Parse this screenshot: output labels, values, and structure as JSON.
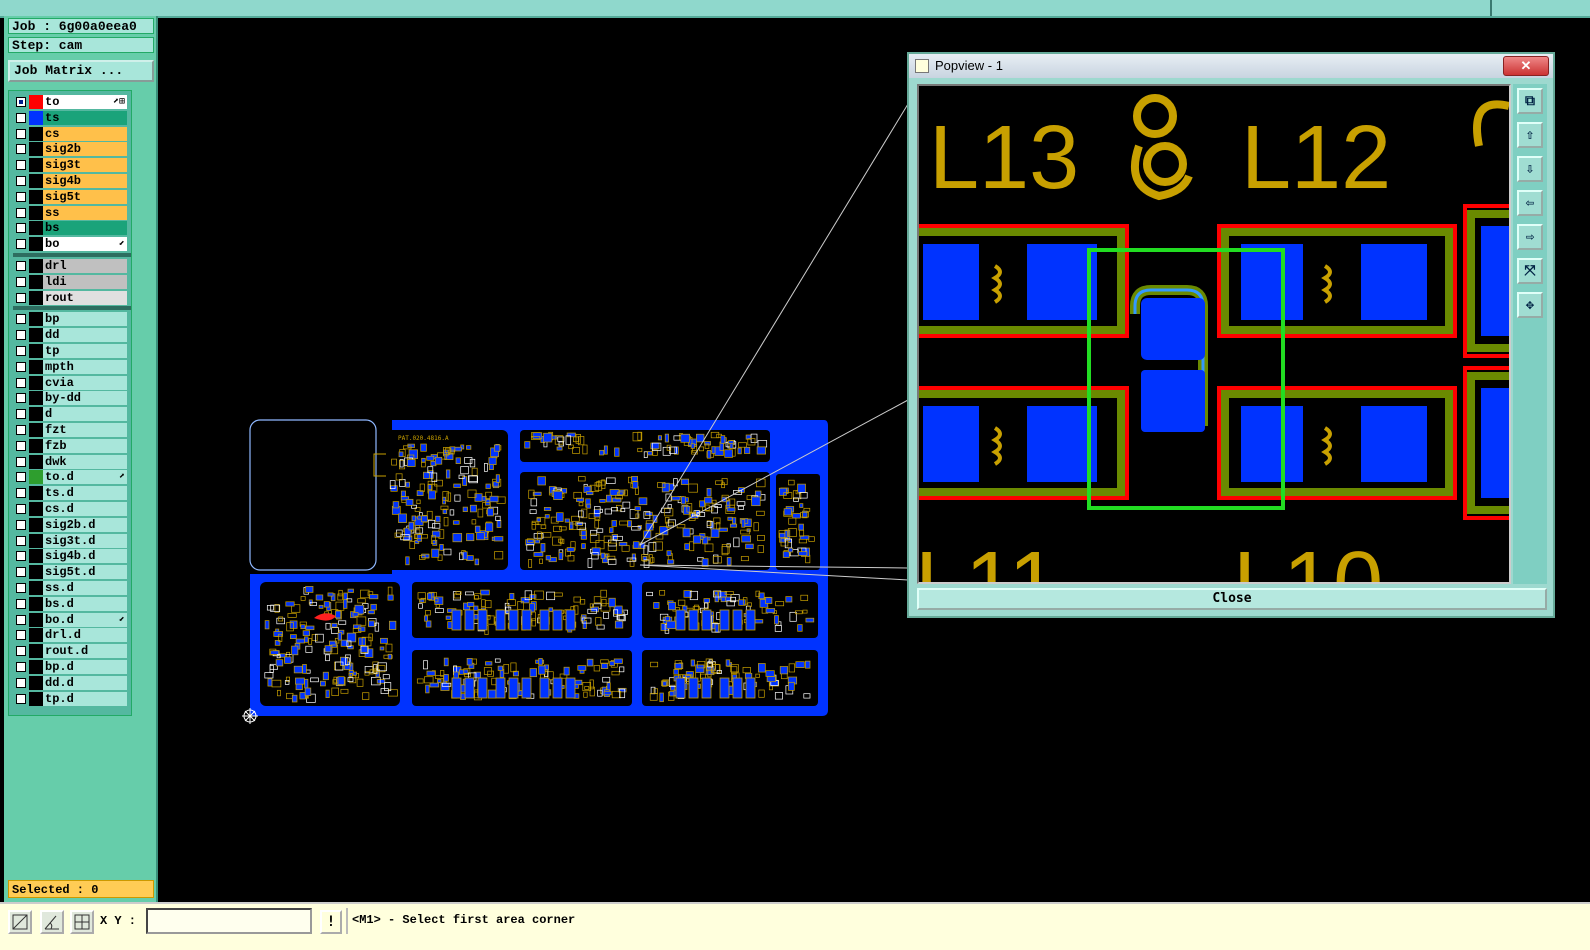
{
  "header": {
    "job_label": "Job : 6g00a0eea0",
    "step_label": "Step: cam",
    "job_matrix_button": "Job Matrix ..."
  },
  "layers": {
    "board": [
      {
        "name": "to",
        "bg": "#ffffff",
        "swatch": "#ff0000",
        "checked": true,
        "mark": "⬈⊞"
      },
      {
        "name": "ts",
        "bg": "#1aa37a",
        "swatch": "#0033ff",
        "checked": false,
        "mark": ""
      },
      {
        "name": "cs",
        "bg": "#ffc04a",
        "swatch": "#000000",
        "checked": false,
        "mark": ""
      },
      {
        "name": "sig2b",
        "bg": "#ffc04a",
        "swatch": "#000000",
        "checked": false,
        "mark": ""
      },
      {
        "name": "sig3t",
        "bg": "#ffc04a",
        "swatch": "#000000",
        "checked": false,
        "mark": ""
      },
      {
        "name": "sig4b",
        "bg": "#ffc04a",
        "swatch": "#000000",
        "checked": false,
        "mark": ""
      },
      {
        "name": "sig5t",
        "bg": "#ffc04a",
        "swatch": "#000000",
        "checked": false,
        "mark": ""
      },
      {
        "name": "ss",
        "bg": "#ffc04a",
        "swatch": "#000000",
        "checked": false,
        "mark": ""
      },
      {
        "name": "bs",
        "bg": "#1aa37a",
        "swatch": "#000000",
        "checked": false,
        "mark": ""
      },
      {
        "name": "bo",
        "bg": "#ffffff",
        "swatch": "#000000",
        "checked": false,
        "mark": "⬋"
      }
    ],
    "drill": [
      {
        "name": "drl",
        "bg": "#c0c0c0",
        "swatch": "#000000",
        "checked": false,
        "mark": ""
      },
      {
        "name": "ldi",
        "bg": "#c0c0c0",
        "swatch": "#000000",
        "checked": false,
        "mark": ""
      },
      {
        "name": "rout",
        "bg": "#e0e0e0",
        "swatch": "#000000",
        "checked": false,
        "mark": ""
      }
    ],
    "misc": [
      {
        "name": "bp",
        "bg": "#a8e6da",
        "swatch": "#000000",
        "checked": false,
        "mark": ""
      },
      {
        "name": "dd",
        "bg": "#a8e6da",
        "swatch": "#000000",
        "checked": false,
        "mark": ""
      },
      {
        "name": "tp",
        "bg": "#a8e6da",
        "swatch": "#000000",
        "checked": false,
        "mark": ""
      },
      {
        "name": "mpth",
        "bg": "#a8e6da",
        "swatch": "#000000",
        "checked": false,
        "mark": ""
      },
      {
        "name": "cvia",
        "bg": "#a8e6da",
        "swatch": "#000000",
        "checked": false,
        "mark": ""
      },
      {
        "name": "by-dd",
        "bg": "#a8e6da",
        "swatch": "#000000",
        "checked": false,
        "mark": ""
      },
      {
        "name": "d",
        "bg": "#a8e6da",
        "swatch": "#000000",
        "checked": false,
        "mark": ""
      },
      {
        "name": "fzt",
        "bg": "#a8e6da",
        "swatch": "#000000",
        "checked": false,
        "mark": ""
      },
      {
        "name": "fzb",
        "bg": "#a8e6da",
        "swatch": "#000000",
        "checked": false,
        "mark": ""
      },
      {
        "name": "dwk",
        "bg": "#a8e6da",
        "swatch": "#000000",
        "checked": false,
        "mark": ""
      },
      {
        "name": "to.d",
        "bg": "#a8e6da",
        "swatch": "#2e9e2e",
        "checked": false,
        "mark": "⬈"
      },
      {
        "name": "ts.d",
        "bg": "#a8e6da",
        "swatch": "#000000",
        "checked": false,
        "mark": ""
      },
      {
        "name": "cs.d",
        "bg": "#a8e6da",
        "swatch": "#000000",
        "checked": false,
        "mark": ""
      },
      {
        "name": "sig2b.d",
        "bg": "#a8e6da",
        "swatch": "#000000",
        "checked": false,
        "mark": ""
      },
      {
        "name": "sig3t.d",
        "bg": "#a8e6da",
        "swatch": "#000000",
        "checked": false,
        "mark": ""
      },
      {
        "name": "sig4b.d",
        "bg": "#a8e6da",
        "swatch": "#000000",
        "checked": false,
        "mark": ""
      },
      {
        "name": "sig5t.d",
        "bg": "#a8e6da",
        "swatch": "#000000",
        "checked": false,
        "mark": ""
      },
      {
        "name": "ss.d",
        "bg": "#a8e6da",
        "swatch": "#000000",
        "checked": false,
        "mark": ""
      },
      {
        "name": "bs.d",
        "bg": "#a8e6da",
        "swatch": "#000000",
        "checked": false,
        "mark": ""
      },
      {
        "name": "bo.d",
        "bg": "#a8e6da",
        "swatch": "#000000",
        "checked": false,
        "mark": "⬋"
      },
      {
        "name": "drl.d",
        "bg": "#a8e6da",
        "swatch": "#000000",
        "checked": false,
        "mark": ""
      },
      {
        "name": "rout.d",
        "bg": "#a8e6da",
        "swatch": "#000000",
        "checked": false,
        "mark": ""
      },
      {
        "name": "bp.d",
        "bg": "#a8e6da",
        "swatch": "#000000",
        "checked": false,
        "mark": ""
      },
      {
        "name": "dd.d",
        "bg": "#a8e6da",
        "swatch": "#000000",
        "checked": false,
        "mark": ""
      },
      {
        "name": "tp.d",
        "bg": "#a8e6da",
        "swatch": "#000000",
        "checked": false,
        "mark": ""
      }
    ]
  },
  "status": {
    "selected": "Selected : 0",
    "xy_label": "X Y :",
    "xy_value": "",
    "info_button": "!",
    "prompt": "<M1> - Select first area corner"
  },
  "popview": {
    "title": "Popview - 1",
    "close_x": "✕",
    "close_button": "Close",
    "silk_labels": [
      "L13",
      "L12",
      "L11",
      "L10"
    ],
    "tool_icons": [
      "zoom-window-icon",
      "pan-up-icon",
      "pan-down-icon",
      "pan-left-icon",
      "pan-right-icon",
      "zoom-fit-icon",
      "zoom-home-icon"
    ]
  },
  "board_silk": "PAT.020.4816.A",
  "colors": {
    "background": "#000000",
    "copper": "#0033ff",
    "silk": "#c8a000",
    "mask": "#ff0000",
    "highlight": "#00ff00",
    "panel": "#66cdaa"
  }
}
